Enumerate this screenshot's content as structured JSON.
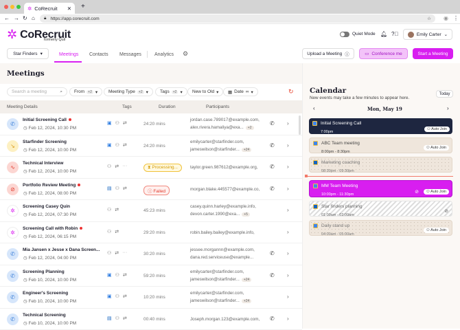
{
  "browser": {
    "tab_title": "CoRecruit",
    "url": "https://app.corecruit.com"
  },
  "app": {
    "logo": "CoRecruit",
    "formerly": "formerly Quil",
    "quiet_mode": "Quiet Mode",
    "quiet_mode_on": false,
    "user": "Emily Carter",
    "accent": "#d81ef0"
  },
  "nav": {
    "workspace": "Star Finders",
    "tabs": [
      "Meetings",
      "Contacts",
      "Messages",
      "Analytics"
    ],
    "active": "Meetings",
    "upload": "Upload a Meeting",
    "conference": "Conference me",
    "start": "Start a Meeting"
  },
  "meetings": {
    "title": "Meetings",
    "search_placeholder": "Search a meeting",
    "filters": [
      {
        "label": "From",
        "count": "+2"
      },
      {
        "label": "Meeting Type",
        "count": "+2"
      },
      {
        "label": "Tags",
        "count": "+2"
      },
      {
        "label": "New to Old"
      },
      {
        "label": "Date"
      }
    ],
    "columns": [
      "Meeting Details",
      "Tags",
      "Duration",
      "Participants"
    ],
    "rows": [
      {
        "title": "Initial Screening Call",
        "dot": true,
        "date": "Feb 12, 2024, 10:30 PM",
        "icon": "phone",
        "tags": [
          "gcal",
          "user",
          "repeat"
        ],
        "duration": "24:20 mins",
        "p1": "jordan.case.789017@example.com,",
        "p2": "alex.rivera.hamaliya@exa...",
        "more": "+2",
        "phone": true
      },
      {
        "title": "Starfinder Screening",
        "dot": false,
        "date": "Feb 12, 2024, 10:00 PM",
        "icon": "missed",
        "tags": [
          "gcal",
          "user",
          "repeat"
        ],
        "duration": "24:20 mins",
        "p1": "emilycarter@starfinder.com,",
        "p2": "jameswilson@starfinder...",
        "more": "+24",
        "phone": true
      },
      {
        "title": "Technical Interview",
        "dot": false,
        "date": "Feb 12, 2024, 10:00 PM",
        "icon": "wave",
        "tags": [
          "user",
          "repeat",
          "more"
        ],
        "status": "Processing...",
        "p1": "taylor.green.987612@example.org,",
        "phone": true
      },
      {
        "title": "Portfolio Review Meeting",
        "dot": true,
        "date": "Feb 12, 2024, 08:00 PM",
        "icon": "blocked",
        "tags": [
          "outlook",
          "user",
          "repeat"
        ],
        "status": "Failed",
        "p1": "morgan.blake.445577@example.co,",
        "phone": true
      },
      {
        "title": "Screening Casey Quin",
        "dot": false,
        "date": "Feb 12, 2024, 07:30 PM",
        "icon": "logo",
        "tags": [
          "user",
          "repeat"
        ],
        "duration": "45:23 mins",
        "p1": "casey.quinn.harley@example.info,",
        "p2": "devon.carter.1990@exa...",
        "more": "+5",
        "phone": false
      },
      {
        "title": "Screening Call with Robin",
        "dot": true,
        "date": "Feb 12, 2024, 06:15 PM",
        "icon": "logo",
        "tags": [
          "user",
          "repeat"
        ],
        "duration": "29:20 mins",
        "p1": "robin.bailey.bailey@example.info,",
        "phone": false
      },
      {
        "title": "Mia Jansen x Jesse x Dana Screen...",
        "dot": false,
        "date": "Feb 12, 2024, 04:00 PM",
        "icon": "phone",
        "tags": [
          "user",
          "repeat",
          "more"
        ],
        "duration": "30:20 mins",
        "p1": "jessee.morgannn@example.com,",
        "p2": "dana.red.serviceuse@example...",
        "phone": true
      },
      {
        "title": "Screening Planning",
        "dot": false,
        "date": "Feb 10, 2024, 10:00 PM",
        "icon": "phone",
        "tags": [
          "gcal",
          "user",
          "repeat"
        ],
        "duration": "59:20 mins",
        "p1": "emilycarter@starfinder.com,",
        "p2": "jameswilson@starfinder...",
        "more": "+24",
        "phone": true
      },
      {
        "title": "Engineer's Screening",
        "dot": false,
        "date": "Feb 10, 2024, 10:00 PM",
        "icon": "phone",
        "tags": [
          "gcal",
          "user",
          "repeat"
        ],
        "duration": "10:20 mins",
        "p1": "emilycarter@starfinder.com,",
        "p2": "jameswilson@starfinder...",
        "more": "+24",
        "phone": false
      },
      {
        "title": "Technical Screening",
        "dot": false,
        "date": "Feb 10, 2024, 10:00 PM",
        "icon": "phone",
        "tags": [
          "outlook",
          "user",
          "repeat"
        ],
        "duration": "00:40 mins",
        "p1": "Joseph.morgan.123@example.com,",
        "phone": true
      }
    ]
  },
  "calendar": {
    "title": "Calendar",
    "subtitle": "New events may take a few minutes to appear here.",
    "today": "Today",
    "date": "Mon, May 19",
    "auto_join": "Auto Join",
    "events": [
      {
        "title": "Initial Screening Call",
        "time": "7:00pm",
        "style": "dark",
        "source": "gcal",
        "auto_join": true
      },
      {
        "title": "ABC Team meeting",
        "time": "8:00pm - 8:30pm",
        "style": "beige",
        "source": "gcal",
        "auto_join": true
      },
      {
        "title": "Marketing coaching",
        "time": "08:30pm - 09:30pm",
        "style": "dotted",
        "source": "outlook",
        "auto_join": false
      },
      {
        "title": "MM Team Meeting",
        "time": "10:00pm - 11:30pm",
        "style": "active",
        "source": "gcal",
        "auto_join": true
      },
      {
        "title": "Star finders planning",
        "time": "01:00am - 02:00am",
        "style": "striped",
        "source": "outlook",
        "auto_join": false
      },
      {
        "title": "Daily stand up",
        "time": "04:00am - 05:00am",
        "style": "dotted",
        "source": "gcal",
        "auto_join": true
      }
    ]
  }
}
